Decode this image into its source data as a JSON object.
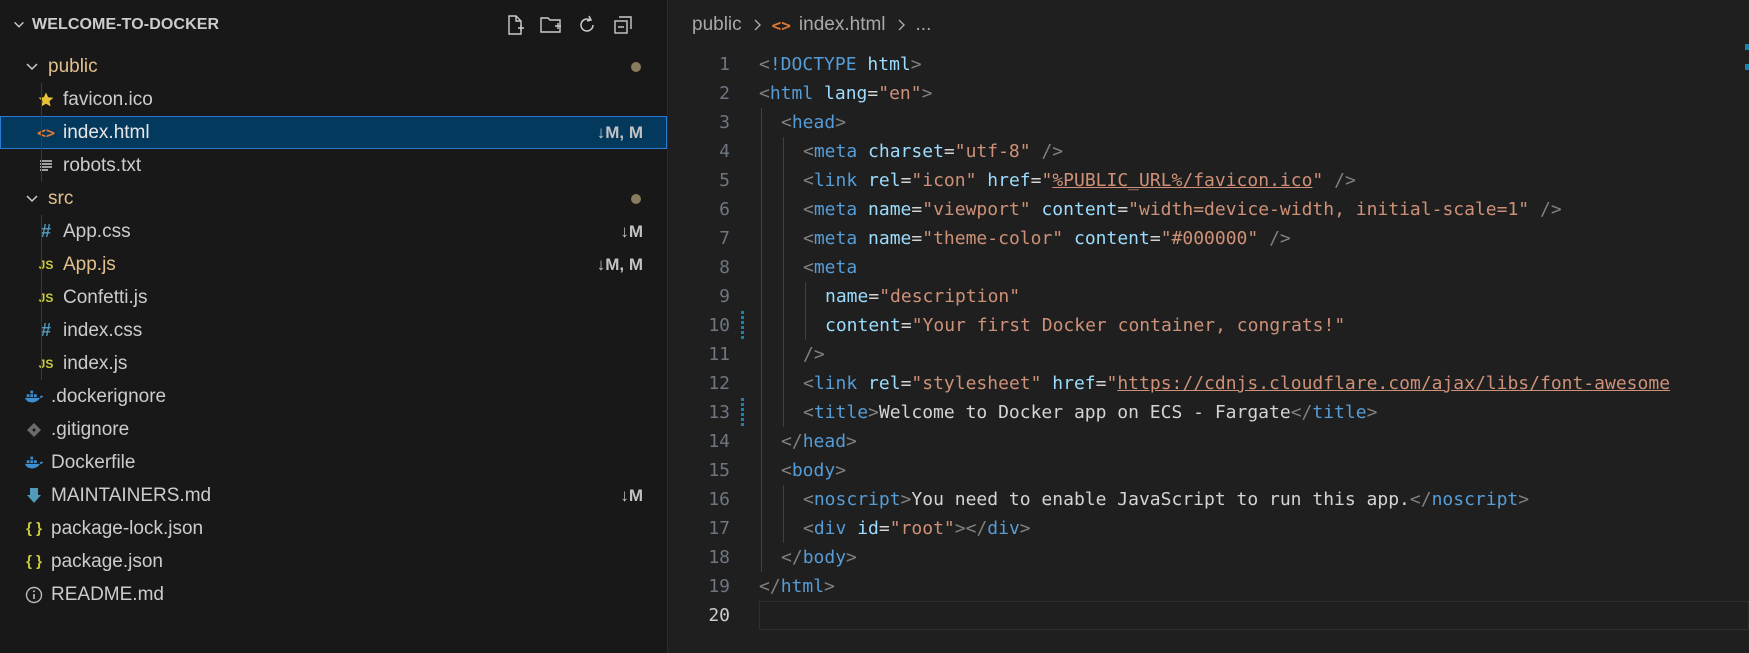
{
  "explorer": {
    "title": "WELCOME-TO-DOCKER",
    "actions": [
      "new-file-icon",
      "new-folder-icon",
      "refresh-icon",
      "collapse-all-icon"
    ],
    "items": [
      {
        "label": "public",
        "type": "folder",
        "depth": 0,
        "open": true,
        "badge": "dot",
        "color": "#e2c08d"
      },
      {
        "label": "favicon.ico",
        "type": "file",
        "icon": "star-icon",
        "depth": 1,
        "status": "",
        "color": "#cccccc"
      },
      {
        "label": "index.html",
        "type": "file",
        "icon": "html-icon",
        "depth": 1,
        "status": "↓M, M",
        "color": "#e6e6e6",
        "selected": true
      },
      {
        "label": "robots.txt",
        "type": "file",
        "icon": "text-file-icon",
        "depth": 1,
        "status": "",
        "color": "#cccccc"
      },
      {
        "label": "src",
        "type": "folder",
        "depth": 0,
        "open": true,
        "badge": "dot",
        "color": "#e2c08d"
      },
      {
        "label": "App.css",
        "type": "file",
        "icon": "css-icon",
        "depth": 1,
        "status": "↓M",
        "color": "#cccccc"
      },
      {
        "label": "App.js",
        "type": "file",
        "icon": "js-icon",
        "depth": 1,
        "status": "↓M, M",
        "color": "#e2c08d"
      },
      {
        "label": "Confetti.js",
        "type": "file",
        "icon": "js-icon",
        "depth": 1,
        "status": "",
        "color": "#cccccc"
      },
      {
        "label": "index.css",
        "type": "file",
        "icon": "css-icon",
        "depth": 1,
        "status": "",
        "color": "#cccccc"
      },
      {
        "label": "index.js",
        "type": "file",
        "icon": "js-icon",
        "depth": 1,
        "status": "",
        "color": "#cccccc"
      },
      {
        "label": ".dockerignore",
        "type": "file",
        "icon": "docker-icon",
        "depth": 0,
        "status": "",
        "color": "#cccccc",
        "dim": true
      },
      {
        "label": ".gitignore",
        "type": "file",
        "icon": "git-icon",
        "depth": 0,
        "status": "",
        "color": "#cccccc"
      },
      {
        "label": "Dockerfile",
        "type": "file",
        "icon": "docker-icon",
        "depth": 0,
        "status": "",
        "color": "#cccccc"
      },
      {
        "label": "MAINTAINERS.md",
        "type": "file",
        "icon": "markdown-download-icon",
        "depth": 0,
        "status": "↓M",
        "color": "#cccccc"
      },
      {
        "label": "package-lock.json",
        "type": "file",
        "icon": "json-icon",
        "depth": 0,
        "status": "",
        "color": "#cccccc"
      },
      {
        "label": "package.json",
        "type": "file",
        "icon": "json-icon",
        "depth": 0,
        "status": "",
        "color": "#cccccc"
      },
      {
        "label": "README.md",
        "type": "file",
        "icon": "info-icon",
        "depth": 0,
        "status": "",
        "color": "#cccccc"
      }
    ]
  },
  "breadcrumb": {
    "folder": "public",
    "file": "index.html",
    "more": "..."
  },
  "editor": {
    "active_line": 20,
    "lines": [
      {
        "n": "1",
        "indent": 0,
        "tokens": [
          [
            "p",
            "<"
          ],
          [
            "t",
            "!DOCTYPE"
          ],
          [
            "x",
            " "
          ],
          [
            "a",
            "html"
          ],
          [
            "p",
            ">"
          ]
        ]
      },
      {
        "n": "2",
        "indent": 0,
        "tokens": [
          [
            "p",
            "<"
          ],
          [
            "t",
            "html"
          ],
          [
            "x",
            " "
          ],
          [
            "a",
            "lang"
          ],
          [
            "x",
            "="
          ],
          [
            "s",
            "\"en\""
          ],
          [
            "p",
            ">"
          ]
        ]
      },
      {
        "n": "3",
        "indent": 1,
        "tokens": [
          [
            "p",
            "<"
          ],
          [
            "t",
            "head"
          ],
          [
            "p",
            ">"
          ]
        ]
      },
      {
        "n": "4",
        "indent": 2,
        "tokens": [
          [
            "p",
            "<"
          ],
          [
            "t",
            "meta"
          ],
          [
            "x",
            " "
          ],
          [
            "a",
            "charset"
          ],
          [
            "x",
            "="
          ],
          [
            "s",
            "\"utf-8\""
          ],
          [
            "x",
            " "
          ],
          [
            "p",
            "/>"
          ]
        ]
      },
      {
        "n": "5",
        "indent": 2,
        "tokens": [
          [
            "p",
            "<"
          ],
          [
            "t",
            "link"
          ],
          [
            "x",
            " "
          ],
          [
            "a",
            "rel"
          ],
          [
            "x",
            "="
          ],
          [
            "s",
            "\"icon\""
          ],
          [
            "x",
            " "
          ],
          [
            "a",
            "href"
          ],
          [
            "x",
            "="
          ],
          [
            "s",
            "\""
          ],
          [
            "l",
            "%PUBLIC_URL%/favicon.ico"
          ],
          [
            "s",
            "\""
          ],
          [
            "x",
            " "
          ],
          [
            "p",
            "/>"
          ]
        ]
      },
      {
        "n": "6",
        "indent": 2,
        "tokens": [
          [
            "p",
            "<"
          ],
          [
            "t",
            "meta"
          ],
          [
            "x",
            " "
          ],
          [
            "a",
            "name"
          ],
          [
            "x",
            "="
          ],
          [
            "s",
            "\"viewport\""
          ],
          [
            "x",
            " "
          ],
          [
            "a",
            "content"
          ],
          [
            "x",
            "="
          ],
          [
            "s",
            "\"width=device-width, initial-scale=1\""
          ],
          [
            "x",
            " "
          ],
          [
            "p",
            "/>"
          ]
        ]
      },
      {
        "n": "7",
        "indent": 2,
        "tokens": [
          [
            "p",
            "<"
          ],
          [
            "t",
            "meta"
          ],
          [
            "x",
            " "
          ],
          [
            "a",
            "name"
          ],
          [
            "x",
            "="
          ],
          [
            "s",
            "\"theme-color\""
          ],
          [
            "x",
            " "
          ],
          [
            "a",
            "content"
          ],
          [
            "x",
            "="
          ],
          [
            "s",
            "\"#000000\""
          ],
          [
            "x",
            " "
          ],
          [
            "p",
            "/>"
          ]
        ]
      },
      {
        "n": "8",
        "indent": 2,
        "tokens": [
          [
            "p",
            "<"
          ],
          [
            "t",
            "meta"
          ]
        ]
      },
      {
        "n": "9",
        "indent": 3,
        "tokens": [
          [
            "a",
            "name"
          ],
          [
            "x",
            "="
          ],
          [
            "s",
            "\"description\""
          ]
        ]
      },
      {
        "n": "10",
        "indent": 3,
        "gutter": true,
        "tokens": [
          [
            "a",
            "content"
          ],
          [
            "x",
            "="
          ],
          [
            "s",
            "\"Your first Docker container, congrats!\""
          ]
        ]
      },
      {
        "n": "11",
        "indent": 2,
        "tokens": [
          [
            "p",
            "/>"
          ]
        ]
      },
      {
        "n": "12",
        "indent": 2,
        "tokens": [
          [
            "p",
            "<"
          ],
          [
            "t",
            "link"
          ],
          [
            "x",
            " "
          ],
          [
            "a",
            "rel"
          ],
          [
            "x",
            "="
          ],
          [
            "s",
            "\"stylesheet\""
          ],
          [
            "x",
            " "
          ],
          [
            "a",
            "href"
          ],
          [
            "x",
            "="
          ],
          [
            "s",
            "\""
          ],
          [
            "l",
            "https://cdnjs.cloudflare.com/ajax/libs/font-awesome"
          ]
        ]
      },
      {
        "n": "13",
        "indent": 2,
        "gutter": true,
        "tokens": [
          [
            "p",
            "<"
          ],
          [
            "t",
            "title"
          ],
          [
            "p",
            ">"
          ],
          [
            "x",
            "Welcome to Docker app on ECS - Fargate"
          ],
          [
            "p",
            "</"
          ],
          [
            "t",
            "title"
          ],
          [
            "p",
            ">"
          ]
        ]
      },
      {
        "n": "14",
        "indent": 1,
        "tokens": [
          [
            "p",
            "</"
          ],
          [
            "t",
            "head"
          ],
          [
            "p",
            ">"
          ]
        ]
      },
      {
        "n": "15",
        "indent": 1,
        "tokens": [
          [
            "p",
            "<"
          ],
          [
            "t",
            "body"
          ],
          [
            "p",
            ">"
          ]
        ]
      },
      {
        "n": "16",
        "indent": 2,
        "tokens": [
          [
            "p",
            "<"
          ],
          [
            "t",
            "noscript"
          ],
          [
            "p",
            ">"
          ],
          [
            "x",
            "You need to enable JavaScript to run this app."
          ],
          [
            "p",
            "</"
          ],
          [
            "t",
            "noscript"
          ],
          [
            "p",
            ">"
          ]
        ]
      },
      {
        "n": "17",
        "indent": 2,
        "tokens": [
          [
            "p",
            "<"
          ],
          [
            "t",
            "div"
          ],
          [
            "x",
            " "
          ],
          [
            "a",
            "id"
          ],
          [
            "x",
            "="
          ],
          [
            "s",
            "\"root\""
          ],
          [
            "p",
            "></"
          ],
          [
            "t",
            "div"
          ],
          [
            "p",
            ">"
          ]
        ]
      },
      {
        "n": "18",
        "indent": 1,
        "tokens": [
          [
            "p",
            "</"
          ],
          [
            "t",
            "body"
          ],
          [
            "p",
            ">"
          ]
        ]
      },
      {
        "n": "19",
        "indent": 0,
        "tokens": [
          [
            "p",
            "</"
          ],
          [
            "t",
            "html"
          ],
          [
            "p",
            ">"
          ]
        ]
      },
      {
        "n": "20",
        "indent": 0,
        "tokens": []
      }
    ]
  }
}
